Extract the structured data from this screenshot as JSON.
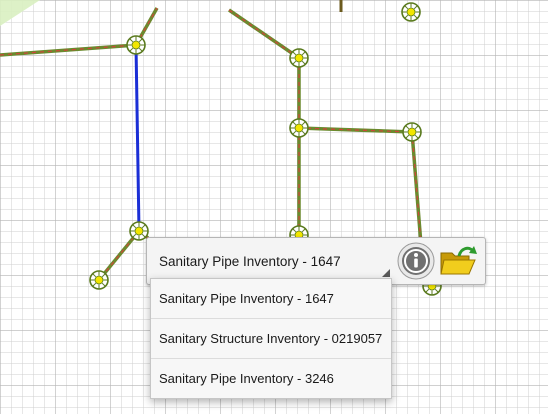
{
  "popup": {
    "selected_feature": "Sanitary Pipe Inventory - 1647",
    "info_icon": "info-icon",
    "folder_icon": "open-folder-icon"
  },
  "menu": {
    "items": [
      {
        "label": "Sanitary Pipe Inventory - 1647"
      },
      {
        "label": "Sanitary Structure Inventory - 0219057"
      },
      {
        "label": "Sanitary Pipe Inventory - 3246"
      }
    ]
  },
  "colors": {
    "grid_line": "#c8c8c8",
    "pipe": "#6b8a2e",
    "pipe_dash": "#d0453a",
    "selected_pipe": "#1b2fd6",
    "node_ring": "#5a7a1e",
    "node_center": "#f2e600",
    "info_button": "#6e6e6e",
    "folder": "#e8c210"
  }
}
